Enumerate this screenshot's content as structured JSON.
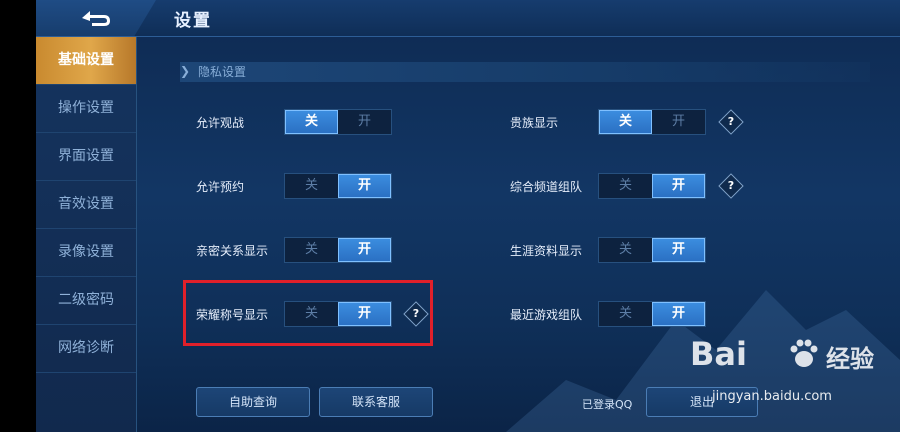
{
  "header": {
    "title": "设置"
  },
  "sidebar": {
    "items": [
      {
        "label": "基础设置",
        "active": true
      },
      {
        "label": "操作设置",
        "active": false
      },
      {
        "label": "界面设置",
        "active": false
      },
      {
        "label": "音效设置",
        "active": false
      },
      {
        "label": "录像设置",
        "active": false
      },
      {
        "label": "二级密码",
        "active": false
      },
      {
        "label": "网络诊断",
        "active": false
      }
    ]
  },
  "section": {
    "title": "隐私设置"
  },
  "toggle_text": {
    "off": "关",
    "on": "开"
  },
  "settings": {
    "allow_spectate": {
      "label": "允许观战",
      "value": "关"
    },
    "allow_reservation": {
      "label": "允许预约",
      "value": "开"
    },
    "intimacy_display": {
      "label": "亲密关系显示",
      "value": "开"
    },
    "honor_title_display": {
      "label": "荣耀称号显示",
      "value": "开"
    },
    "noble_display": {
      "label": "贵族显示",
      "value": "关"
    },
    "channel_team": {
      "label": "综合频道组队",
      "value": "开"
    },
    "career_display": {
      "label": "生涯资料显示",
      "value": "开"
    },
    "recent_game_team": {
      "label": "最近游戏组队",
      "value": "开"
    }
  },
  "help_symbol": "?",
  "footer": {
    "self_service": "自助查询",
    "contact_support": "联系客服",
    "logged_in": "已登录QQ",
    "logout": "退出"
  },
  "watermark": {
    "brand": "Bai",
    "brand_cn": "经验",
    "url": "jingyan.baidu.com"
  },
  "colors": {
    "accent_active": "#d99a3e",
    "toggle_on": "#2f7fd6",
    "highlight": "#e0202a"
  }
}
